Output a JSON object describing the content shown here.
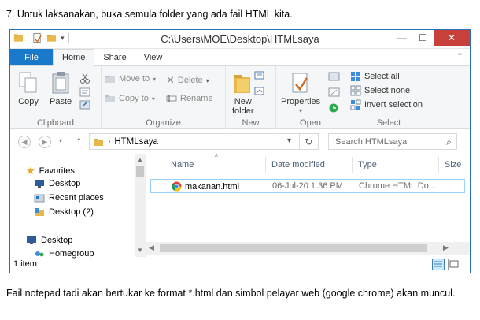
{
  "doc": {
    "top_text": "7. Untuk laksanakan, buka semula folder yang ada fail HTML kita.",
    "bottom_text": "Fail notepad tadi akan bertukar ke format *.html dan simbol pelayar web (google chrome) akan muncul."
  },
  "window": {
    "title": "C:\\Users\\MOE\\Desktop\\HTMLsaya",
    "minimize": "—",
    "maximize": "☐",
    "close": "✕"
  },
  "tabs": {
    "file": "File",
    "home": "Home",
    "share": "Share",
    "view": "View"
  },
  "ribbon": {
    "clipboard": {
      "copy": "Copy",
      "paste": "Paste",
      "label": "Clipboard"
    },
    "organize": {
      "move_to": "Move to",
      "copy_to": "Copy to",
      "delete": "Delete",
      "rename": "Rename",
      "label": "Organize"
    },
    "new": {
      "new_folder_line1": "New",
      "new_folder_line2": "folder",
      "label": "New"
    },
    "open": {
      "properties": "Properties",
      "label": "Open"
    },
    "select": {
      "select_all": "Select all",
      "select_none": "Select none",
      "invert_selection": "Invert selection",
      "label": "Select"
    }
  },
  "address": {
    "crumb": "HTMLsaya",
    "search_placeholder": "Search HTMLsaya"
  },
  "nav": {
    "favorites": "Favorites",
    "desktop": "Desktop",
    "recent_places": "Recent places",
    "desktop2": "Desktop (2)",
    "desktop_root": "Desktop",
    "homegroup": "Homegroup"
  },
  "columns": {
    "name": "Name",
    "date_modified": "Date modified",
    "type": "Type",
    "size": "Size"
  },
  "files": [
    {
      "name": "makanan.html",
      "date": "06-Jul-20 1:36 PM",
      "type": "Chrome HTML Do..."
    }
  ],
  "status": {
    "count": "1 item"
  },
  "colors": {
    "accent": "#1979ca",
    "close": "#c7413a",
    "selection": "#99d1ff"
  },
  "icons": [
    "folder-icon",
    "chrome-icon",
    "star-icon",
    "desktop-icon",
    "search-icon",
    "refresh-icon"
  ]
}
